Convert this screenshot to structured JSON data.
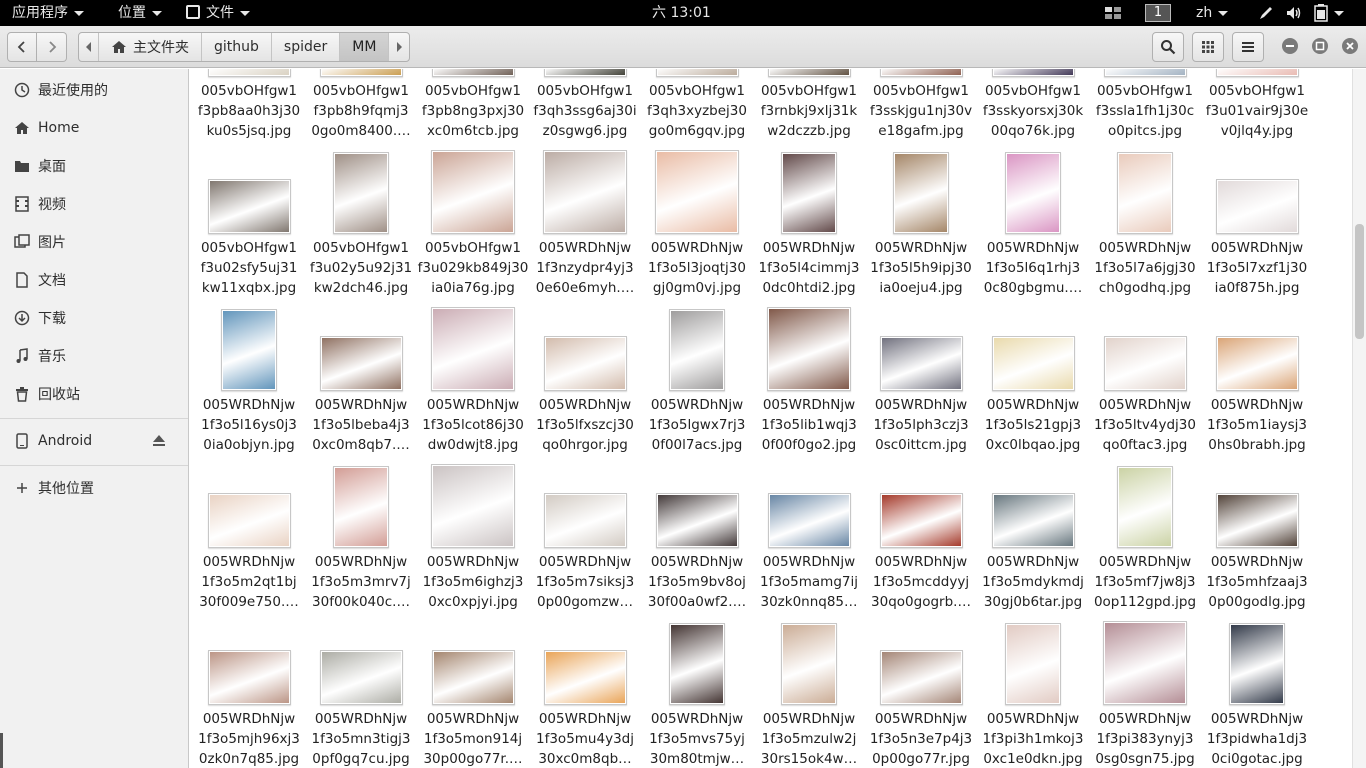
{
  "topbar": {
    "applications": "应用程序",
    "places": "位置",
    "files_menu": "文件",
    "clock": "六 13:01",
    "workspace": "1",
    "input_method": "zh"
  },
  "header": {
    "path": [
      "主文件夹",
      "github",
      "spider",
      "MM"
    ]
  },
  "sidebar": {
    "items": [
      {
        "label": "最近使用的",
        "icon": "recent-icon"
      },
      {
        "label": "Home",
        "icon": "home-icon"
      },
      {
        "label": "桌面",
        "icon": "desktop-folder-icon"
      },
      {
        "label": "视频",
        "icon": "video-icon"
      },
      {
        "label": "图片",
        "icon": "pictures-icon"
      },
      {
        "label": "文档",
        "icon": "documents-icon"
      },
      {
        "label": "下载",
        "icon": "downloads-icon"
      },
      {
        "label": "音乐",
        "icon": "music-icon"
      },
      {
        "label": "回收站",
        "icon": "trash-icon"
      }
    ],
    "devices": [
      {
        "label": "Android",
        "icon": "phone-icon"
      }
    ],
    "other": {
      "label": "其他位置",
      "icon": "plus-icon"
    }
  },
  "files": [
    {
      "name": "005vbOHfgw1f3pb8aa0h3j30ku0s5jsq.jpg",
      "lines": [
        "005vbOHfgw1",
        "f3pb8aa0h3j30",
        "ku0s5jsq.jpg"
      ],
      "color": "#d8d0c0",
      "shape": "l"
    },
    {
      "name": "005vbOHfgw1f3pb8h9fqmj30go0m8400.jpg",
      "lines": [
        "005vbOHfgw1",
        "f3pb8h9fqmj3",
        "0go0m8400.…"
      ],
      "color": "#c89a4a",
      "shape": "l"
    },
    {
      "name": "005vbOHfgw1f3pb8ng3pxj30xc0m6tcb.jpg",
      "lines": [
        "005vbOHfgw1",
        "f3pb8ng3pxj30",
        "xc0m6tcb.jpg"
      ],
      "color": "#6a5a50",
      "shape": "l"
    },
    {
      "name": "005vbOHfgw1f3qh3ssg6aj30iz0sgwg6.jpg",
      "lines": [
        "005vbOHfgw1",
        "f3qh3ssg6aj30i",
        "z0sgwg6.jpg"
      ],
      "color": "#3a3a30",
      "shape": "l"
    },
    {
      "name": "005vbOHfgw1f3qh3xyzbej30go0m6gqv.jpg",
      "lines": [
        "005vbOHfgw1",
        "f3qh3xyzbej30",
        "go0m6gqv.jpg"
      ],
      "color": "#b8a898",
      "shape": "l"
    },
    {
      "name": "005vbOHfgw1f3rnbkj9xlj31kw2dczzb.jpg",
      "lines": [
        "005vbOHfgw1",
        "f3rnbkj9xlj31k",
        "w2dczzb.jpg"
      ],
      "color": "#5a4a3a",
      "shape": "l"
    },
    {
      "name": "005vbOHfgw1f3sskjgu1nj30ve18gafm.jpg",
      "lines": [
        "005vbOHfgw1",
        "f3sskjgu1nj30v",
        "e18gafm.jpg"
      ],
      "color": "#8a5a4a",
      "shape": "l"
    },
    {
      "name": "005vbOHfgw1f3sskyorsxj30k00qo76k.jpg",
      "lines": [
        "005vbOHfgw1",
        "f3sskyorsxj30k",
        "00qo76k.jpg"
      ],
      "color": "#3a3050",
      "shape": "l"
    },
    {
      "name": "005vbOHfgw1f3ssla1fh1j30co0pitcs.jpg",
      "lines": [
        "005vbOHfgw1",
        "f3ssla1fh1j30c",
        "o0pitcs.jpg"
      ],
      "color": "#a0b0c0",
      "shape": "l"
    },
    {
      "name": "005vbOHfgw1f3u01vair9j30ev0jlq4y.jpg",
      "lines": [
        "005vbOHfgw1",
        "f3u01vair9j30e",
        "v0jlq4y.jpg"
      ],
      "color": "#e8b8b0",
      "shape": "l"
    },
    {
      "name": "005vbOHfgw1f3u02sfy5uj31kw11xqbx.jpg",
      "lines": [
        "005vbOHfgw1",
        "f3u02sfy5uj31",
        "kw11xqbx.jpg"
      ],
      "color": "#7a7068",
      "shape": "l"
    },
    {
      "name": "005vbOHfgw1f3u02y5u92j31kw2dch46.jpg",
      "lines": [
        "005vbOHfgw1",
        "f3u02y5u92j31",
        "kw2dch46.jpg"
      ],
      "color": "#9a8a80",
      "shape": "p"
    },
    {
      "name": "005vbOHfgw1f3u029kb849j30ia0ia76g.jpg",
      "lines": [
        "005vbOHfgw1",
        "f3u029kb849j30",
        "ia0ia76g.jpg"
      ],
      "color": "#c8a090",
      "shape": "s"
    },
    {
      "name": "005WRDhNjw1f3nzydpr4yj30e60e6myh.jpg",
      "lines": [
        "005WRDhNjw",
        "1f3nzydpr4yj3",
        "0e60e6myh.…"
      ],
      "color": "#b8a8a0",
      "shape": "s"
    },
    {
      "name": "005WRDhNjw1f3o5l3joqtj30gj0gm0vj.jpg",
      "lines": [
        "005WRDhNjw",
        "1f3o5l3joqtj30",
        "gj0gm0vj.jpg"
      ],
      "color": "#e8b8a0",
      "shape": "s"
    },
    {
      "name": "005WRDhNjw1f3o5l4cimmj30dc0htdi2.jpg",
      "lines": [
        "005WRDhNjw",
        "1f3o5l4cimmj3",
        "0dc0htdi2.jpg"
      ],
      "color": "#5a4040",
      "shape": "p"
    },
    {
      "name": "005WRDhNjw1f3o5l5h9ipj30ia0oeju4.jpg",
      "lines": [
        "005WRDhNjw",
        "1f3o5l5h9ipj30",
        "ia0oeju4.jpg"
      ],
      "color": "#a08060",
      "shape": "p"
    },
    {
      "name": "005WRDhNjw1f3o5l6q1rhj30c80gbgmu.jpg",
      "lines": [
        "005WRDhNjw",
        "1f3o5l6q1rhj3",
        "0c80gbgmu.…"
      ],
      "color": "#d890c0",
      "shape": "p"
    },
    {
      "name": "005WRDhNjw1f3o5l7a6jgj30ch0godhq.jpg",
      "lines": [
        "005WRDhNjw",
        "1f3o5l7a6jgj30",
        "ch0godhq.jpg"
      ],
      "color": "#e8c8b8",
      "shape": "p"
    },
    {
      "name": "005WRDhNjw1f3o5l7xzf1j30ia0f875h.jpg",
      "lines": [
        "005WRDhNjw",
        "1f3o5l7xzf1j30",
        "ia0f875h.jpg"
      ],
      "color": "#e0d8d8",
      "shape": "l"
    },
    {
      "name": "005WRDhNjw1f3o5l16ys0j30ia0objyn.jpg",
      "lines": [
        "005WRDhNjw",
        "1f3o5l16ys0j3",
        "0ia0objyn.jpg"
      ],
      "color": "#5a90b8",
      "shape": "p"
    },
    {
      "name": "005WRDhNjw1f3o5lbeba4j30xc0m8qb7.jpg",
      "lines": [
        "005WRDhNjw",
        "1f3o5lbeba4j3",
        "0xc0m8qb7.…"
      ],
      "color": "#8a6a5a",
      "shape": "l"
    },
    {
      "name": "005WRDhNjw1f3o5lcot86j30dw0dwjt8.jpg",
      "lines": [
        "005WRDhNjw",
        "1f3o5lcot86j30",
        "dw0dwjt8.jpg"
      ],
      "color": "#c8a8b0",
      "shape": "s"
    },
    {
      "name": "005WRDhNjw1f3o5lfxszcj30qo0hrgor.jpg",
      "lines": [
        "005WRDhNjw",
        "1f3o5lfxszcj30",
        "qo0hrgor.jpg"
      ],
      "color": "#d0b8a8",
      "shape": "l"
    },
    {
      "name": "005WRDhNjw1f3o5lgwx7rj30f00l7acs.jpg",
      "lines": [
        "005WRDhNjw",
        "1f3o5lgwx7rj3",
        "0f00l7acs.jpg"
      ],
      "color": "#9a9898",
      "shape": "p"
    },
    {
      "name": "005WRDhNjw1f3o5lib1wqj30f00f0go2.jpg",
      "lines": [
        "005WRDhNjw",
        "1f3o5lib1wqj3",
        "0f00f0go2.jpg"
      ],
      "color": "#7a5040",
      "shape": "s"
    },
    {
      "name": "005WRDhNjw1f3o5lph3czj30sc0ittcm.jpg",
      "lines": [
        "005WRDhNjw",
        "1f3o5lph3czj3",
        "0sc0ittcm.jpg"
      ],
      "color": "#6a6a78",
      "shape": "l"
    },
    {
      "name": "005WRDhNjw1f3o5ls21gpj30xc0lbqao.jpg",
      "lines": [
        "005WRDhNjw",
        "1f3o5ls21gpj3",
        "0xc0lbqao.jpg"
      ],
      "color": "#e8d8a8",
      "shape": "l"
    },
    {
      "name": "005WRDhNjw1f3o5ltv4ydj30qo0ftac3.jpg",
      "lines": [
        "005WRDhNjw",
        "1f3o5ltv4ydj30",
        "qo0ftac3.jpg"
      ],
      "color": "#e0d0c8",
      "shape": "l"
    },
    {
      "name": "005WRDhNjw1f3o5m1iaysj30hs0brabh.jpg",
      "lines": [
        "005WRDhNjw",
        "1f3o5m1iaysj3",
        "0hs0brabh.jpg"
      ],
      "color": "#d8a070",
      "shape": "l"
    },
    {
      "name": "005WRDhNjw1f3o5m2qt1bj30f009e750.jpg",
      "lines": [
        "005WRDhNjw",
        "1f3o5m2qt1bj",
        "30f009e750.…"
      ],
      "color": "#e8d0c0",
      "shape": "l"
    },
    {
      "name": "005WRDhNjw1f3o5m3mrv7j30f00k040c.jpg",
      "lines": [
        "005WRDhNjw",
        "1f3o5m3mrv7j",
        "30f00k040c.…"
      ],
      "color": "#d09890",
      "shape": "p"
    },
    {
      "name": "005WRDhNjw1f3o5m6ighzj30xc0xpjyi.jpg",
      "lines": [
        "005WRDhNjw",
        "1f3o5m6ighzj3",
        "0xc0xpjyi.jpg"
      ],
      "color": "#c8c0c0",
      "shape": "s"
    },
    {
      "name": "005WRDhNjw1f3o5m7siksj30p00gomzw.jpg",
      "lines": [
        "005WRDhNjw",
        "1f3o5m7siksj3",
        "0p00gomzw…"
      ],
      "color": "#d0c8c0",
      "shape": "l"
    },
    {
      "name": "005WRDhNjw1f3o5m9bv8oj30f00a0wf2.jpg",
      "lines": [
        "005WRDhNjw",
        "1f3o5m9bv8oj",
        "30f00a0wf2.…"
      ],
      "color": "#3a3030",
      "shape": "l"
    },
    {
      "name": "005WRDhNjw1f3o5mamg7ij30zk0nnq85.jpg",
      "lines": [
        "005WRDhNjw",
        "1f3o5mamg7ij",
        "30zk0nnq85…"
      ],
      "color": "#6080a0",
      "shape": "l"
    },
    {
      "name": "005WRDhNjw1f3o5mcddyyj30qo0gogrb.jpg",
      "lines": [
        "005WRDhNjw",
        "1f3o5mcddyyj",
        "30qo0gogrb.…"
      ],
      "color": "#a03020",
      "shape": "l"
    },
    {
      "name": "005WRDhNjw1f3o5mdykmdj30gj0b6tar.jpg",
      "lines": [
        "005WRDhNjw",
        "1f3o5mdykmdj",
        "30gj0b6tar.jpg"
      ],
      "color": "#607078",
      "shape": "l"
    },
    {
      "name": "005WRDhNjw1f3o5mf7jw8j30op112gpd.jpg",
      "lines": [
        "005WRDhNjw",
        "1f3o5mf7jw8j3",
        "0op112gpd.jpg"
      ],
      "color": "#c8d0a0",
      "shape": "p"
    },
    {
      "name": "005WRDhNjw1f3o5mhfzaaj30p00godlg.jpg",
      "lines": [
        "005WRDhNjw",
        "1f3o5mhfzaaj3",
        "0p00godlg.jpg"
      ],
      "color": "#4a3a30",
      "shape": "l"
    },
    {
      "name": "005WRDhNjw1f3o5mjh96xj30zk0n7q85.jpg",
      "lines": [
        "005WRDhNjw",
        "1f3o5mjh96xj3",
        "0zk0n7q85.jpg"
      ],
      "color": "#b89080",
      "shape": "l"
    },
    {
      "name": "005WRDhNjw1f3o5mn3tigj30pf0gq7cu.jpg",
      "lines": [
        "005WRDhNjw",
        "1f3o5mn3tigj3",
        "0pf0gq7cu.jpg"
      ],
      "color": "#a8a8a0",
      "shape": "l"
    },
    {
      "name": "005WRDhNjw1f3o5mon914j30p00go77r.jpg",
      "lines": [
        "005WRDhNjw",
        "1f3o5mon914j",
        "30p00go77r.…"
      ],
      "color": "#a08068",
      "shape": "l"
    },
    {
      "name": "005WRDhNjw1f3o5mu4y3dj30xc0m8qb.jpg",
      "lines": [
        "005WRDhNjw",
        "1f3o5mu4y3dj",
        "30xc0m8qb…"
      ],
      "color": "#e8a050",
      "shape": "l"
    },
    {
      "name": "005WRDhNjw1f3o5mvs75yj30m80tmjw.jpg",
      "lines": [
        "005WRDhNjw",
        "1f3o5mvs75yj",
        "30m80tmjw…"
      ],
      "color": "#3a2a28",
      "shape": "p"
    },
    {
      "name": "005WRDhNjw1f3o5mzulw2j30rs15ok4w.jpg",
      "lines": [
        "005WRDhNjw",
        "1f3o5mzulw2j",
        "30rs15ok4w…"
      ],
      "color": "#c8a890",
      "shape": "p"
    },
    {
      "name": "005WRDhNjw1f3o5n3e7p4j30p00go77r.jpg",
      "lines": [
        "005WRDhNjw",
        "1f3o5n3e7p4j3",
        "0p00go77r.jpg"
      ],
      "color": "#a08070",
      "shape": "l"
    },
    {
      "name": "005WRDhNjw1f3pi3h1mkoj30xc1e0dkn.jpg",
      "lines": [
        "005WRDhNjw",
        "1f3pi3h1mkoj3",
        "0xc1e0dkn.jpg"
      ],
      "color": "#e0c8c0",
      "shape": "p"
    },
    {
      "name": "005WRDhNjw1f3pi383ynyj30sg0sgn75.jpg",
      "lines": [
        "005WRDhNjw",
        "1f3pi383ynyj3",
        "0sg0sgn75.jpg"
      ],
      "color": "#b08890",
      "shape": "s"
    },
    {
      "name": "005WRDhNjw1f3pidwha1dj30ci0gotac.jpg",
      "lines": [
        "005WRDhNjw",
        "1f3pidwha1dj3",
        "0ci0gotac.jpg"
      ],
      "color": "#283040",
      "shape": "p"
    }
  ]
}
